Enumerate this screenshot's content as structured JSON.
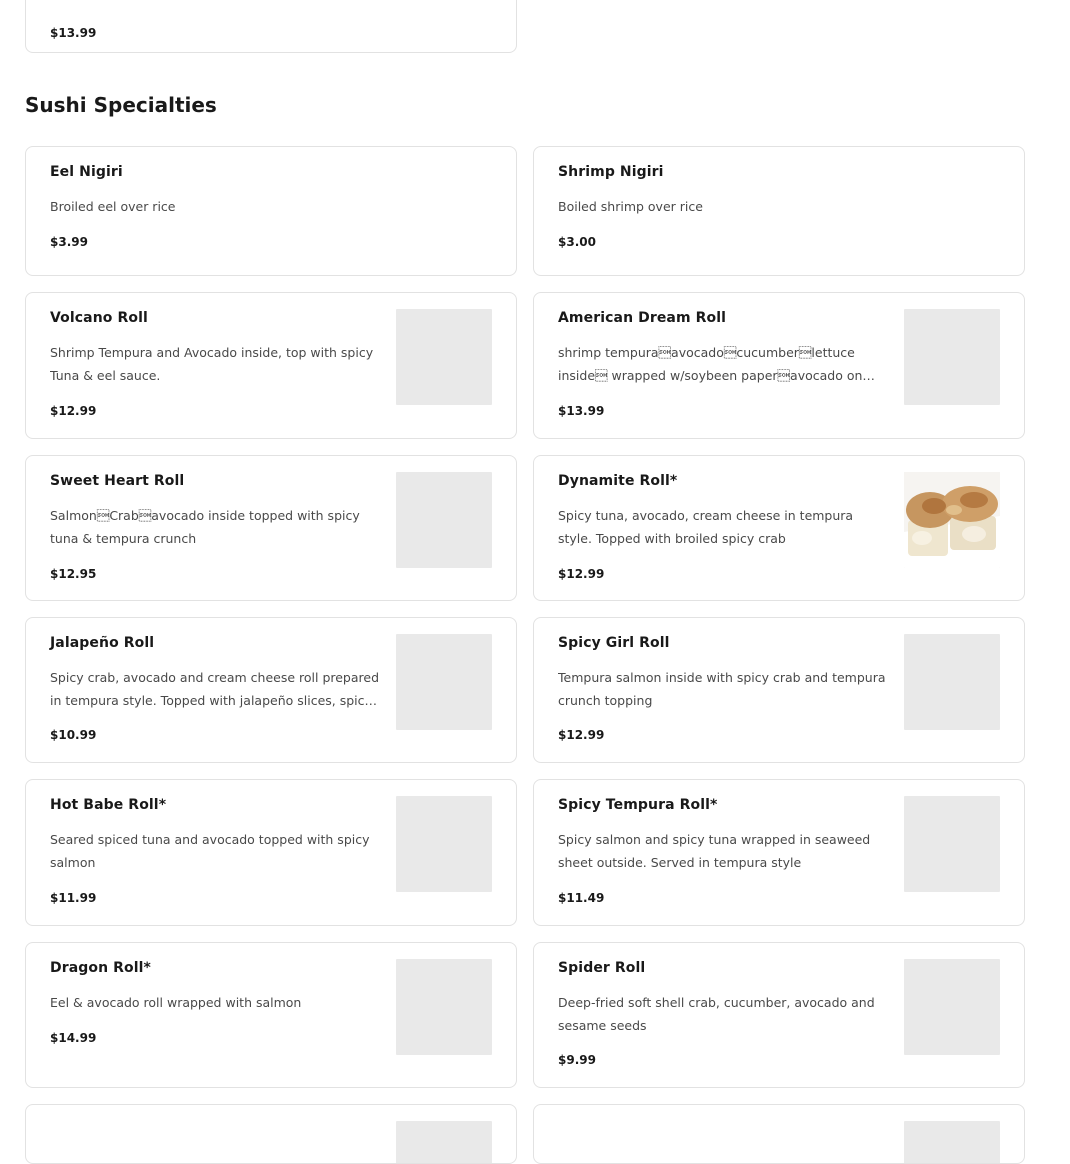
{
  "previous_item": {
    "price": "$13.99"
  },
  "section": {
    "title": "Sushi Specialties",
    "items": [
      {
        "name": "Eel Nigiri",
        "description": "Broiled eel over rice",
        "price": "$3.99"
      },
      {
        "name": "Shrimp Nigiri",
        "description": "Boiled shrimp over rice",
        "price": "$3.00"
      },
      {
        "name": "Volcano Roll",
        "description": "Shrimp Tempura and Avocado inside, top with spicy Tuna & eel sauce.",
        "price": "$12.99"
      },
      {
        "name": "American Dream Roll",
        "description": "shrimp tempura\u0001avocado\u0001cucumber\u0001lettuce inside\u0001 wrapped w/soybeen paper\u0001avocado on top.",
        "price": "$13.99"
      },
      {
        "name": "Sweet Heart Roll",
        "description": "Salmon\u0001Crab\u0001avocado inside topped with spicy tuna & tempura crunch",
        "price": "$12.95"
      },
      {
        "name": "Dynamite Roll*",
        "description": "Spicy tuna, avocado, cream cheese in tempura style. Topped with broiled spicy crab",
        "price": "$12.99"
      },
      {
        "name": "Jalapeño Roll",
        "description": "Spicy crab, avocado and cream cheese roll prepared in tempura style. Topped with jalapeño slices, spicy mayo and eel sauce",
        "price": "$10.99"
      },
      {
        "name": "Spicy Girl Roll",
        "description": "Tempura salmon inside with spicy crab and tempura crunch topping",
        "price": "$12.99"
      },
      {
        "name": "Hot Babe Roll*",
        "description": "Seared spiced tuna and avocado topped with spicy salmon",
        "price": "$11.99"
      },
      {
        "name": "Spicy Tempura Roll*",
        "description": "Spicy salmon and spicy tuna wrapped in seaweed sheet outside. Served in tempura style",
        "price": "$11.49"
      },
      {
        "name": "Dragon Roll*",
        "description": "Eel & avocado roll wrapped with salmon",
        "price": "$14.99"
      },
      {
        "name": "Spider Roll",
        "description": "Deep-fried soft shell crab, cucumber, avocado and sesame seeds",
        "price": "$9.99"
      }
    ]
  }
}
